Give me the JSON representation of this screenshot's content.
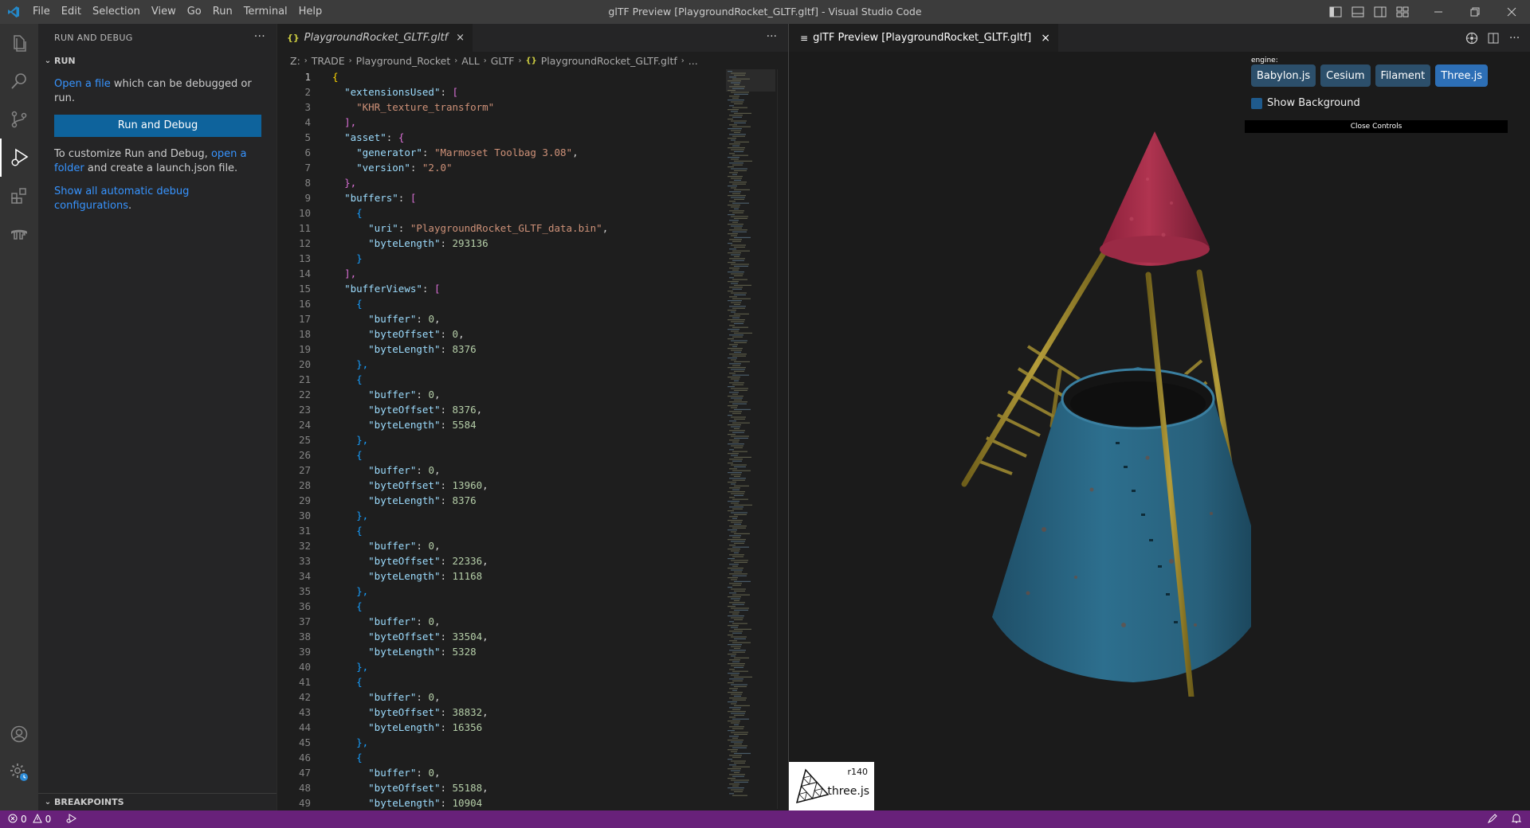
{
  "titlebar": {
    "menu": [
      "File",
      "Edit",
      "Selection",
      "View",
      "Go",
      "Run",
      "Terminal",
      "Help"
    ],
    "title": "glTF Preview [PlaygroundRocket_GLTF.gltf] - Visual Studio Code"
  },
  "sidebar": {
    "header": "RUN AND DEBUG",
    "more": "···",
    "section": "RUN",
    "open_file_link": "Open a file",
    "open_file_rest": " which can be debugged or run.",
    "run_button": "Run and Debug",
    "customize_pre": "To customize Run and Debug, ",
    "open_folder_link": "open a folder",
    "customize_post": " and create a launch.json file.",
    "show_all_link": "Show all automatic debug configurations",
    "show_all_period": ".",
    "breakpoints": "BREAKPOINTS"
  },
  "editor": {
    "tab_icon": "{}",
    "tab_label": "PlaygroundRocket_GLTF.gltf",
    "tab_close": "×",
    "more": "···",
    "breadcrumb": [
      "Z:",
      "TRADE",
      "Playground_Rocket",
      "ALL",
      "GLTF",
      "PlaygroundRocket_GLTF.gltf",
      "..."
    ],
    "breadcrumb_icon": "{}",
    "lines": [
      {
        "n": "1",
        "t": [
          [
            "{",
            "b1"
          ]
        ]
      },
      {
        "n": "2",
        "t": [
          [
            "  ",
            ""
          ],
          [
            "\"extensionsUsed\"",
            "k"
          ],
          [
            ": ",
            ""
          ],
          [
            "[",
            "b2"
          ]
        ]
      },
      {
        "n": "3",
        "t": [
          [
            "    ",
            ""
          ],
          [
            "\"KHR_texture_transform\"",
            "s"
          ]
        ]
      },
      {
        "n": "4",
        "t": [
          [
            "  ",
            ""
          ],
          [
            "],",
            "b2"
          ]
        ]
      },
      {
        "n": "5",
        "t": [
          [
            "  ",
            ""
          ],
          [
            "\"asset\"",
            "k"
          ],
          [
            ": ",
            ""
          ],
          [
            "{",
            "b2"
          ]
        ]
      },
      {
        "n": "6",
        "t": [
          [
            "    ",
            ""
          ],
          [
            "\"generator\"",
            "k"
          ],
          [
            ": ",
            ""
          ],
          [
            "\"Marmoset Toolbag 3.08\"",
            "s"
          ],
          [
            ",",
            ""
          ]
        ]
      },
      {
        "n": "7",
        "t": [
          [
            "    ",
            ""
          ],
          [
            "\"version\"",
            "k"
          ],
          [
            ": ",
            ""
          ],
          [
            "\"2.0\"",
            "s"
          ]
        ]
      },
      {
        "n": "8",
        "t": [
          [
            "  ",
            ""
          ],
          [
            "},",
            "b2"
          ]
        ]
      },
      {
        "n": "9",
        "t": [
          [
            "  ",
            ""
          ],
          [
            "\"buffers\"",
            "k"
          ],
          [
            ": ",
            ""
          ],
          [
            "[",
            "b2"
          ]
        ]
      },
      {
        "n": "10",
        "t": [
          [
            "    ",
            ""
          ],
          [
            "{",
            "b3"
          ]
        ]
      },
      {
        "n": "11",
        "t": [
          [
            "      ",
            ""
          ],
          [
            "\"uri\"",
            "k"
          ],
          [
            ": ",
            ""
          ],
          [
            "\"PlaygroundRocket_GLTF_data.bin\"",
            "s"
          ],
          [
            ",",
            ""
          ]
        ]
      },
      {
        "n": "12",
        "t": [
          [
            "      ",
            ""
          ],
          [
            "\"byteLength\"",
            "k"
          ],
          [
            ": ",
            ""
          ],
          [
            "293136",
            "n"
          ]
        ]
      },
      {
        "n": "13",
        "t": [
          [
            "    ",
            ""
          ],
          [
            "}",
            "b3"
          ]
        ]
      },
      {
        "n": "14",
        "t": [
          [
            "  ",
            ""
          ],
          [
            "],",
            "b2"
          ]
        ]
      },
      {
        "n": "15",
        "t": [
          [
            "  ",
            ""
          ],
          [
            "\"bufferViews\"",
            "k"
          ],
          [
            ": ",
            ""
          ],
          [
            "[",
            "b2"
          ]
        ]
      },
      {
        "n": "16",
        "t": [
          [
            "    ",
            ""
          ],
          [
            "{",
            "b3"
          ]
        ]
      },
      {
        "n": "17",
        "t": [
          [
            "      ",
            ""
          ],
          [
            "\"buffer\"",
            "k"
          ],
          [
            ": ",
            ""
          ],
          [
            "0",
            "n"
          ],
          [
            ",",
            ""
          ]
        ]
      },
      {
        "n": "18",
        "t": [
          [
            "      ",
            ""
          ],
          [
            "\"byteOffset\"",
            "k"
          ],
          [
            ": ",
            ""
          ],
          [
            "0",
            "n"
          ],
          [
            ",",
            ""
          ]
        ]
      },
      {
        "n": "19",
        "t": [
          [
            "      ",
            ""
          ],
          [
            "\"byteLength\"",
            "k"
          ],
          [
            ": ",
            ""
          ],
          [
            "8376",
            "n"
          ]
        ]
      },
      {
        "n": "20",
        "t": [
          [
            "    ",
            ""
          ],
          [
            "},",
            "b3"
          ]
        ]
      },
      {
        "n": "21",
        "t": [
          [
            "    ",
            ""
          ],
          [
            "{",
            "b3"
          ]
        ]
      },
      {
        "n": "22",
        "t": [
          [
            "      ",
            ""
          ],
          [
            "\"buffer\"",
            "k"
          ],
          [
            ": ",
            ""
          ],
          [
            "0",
            "n"
          ],
          [
            ",",
            ""
          ]
        ]
      },
      {
        "n": "23",
        "t": [
          [
            "      ",
            ""
          ],
          [
            "\"byteOffset\"",
            "k"
          ],
          [
            ": ",
            ""
          ],
          [
            "8376",
            "n"
          ],
          [
            ",",
            ""
          ]
        ]
      },
      {
        "n": "24",
        "t": [
          [
            "      ",
            ""
          ],
          [
            "\"byteLength\"",
            "k"
          ],
          [
            ": ",
            ""
          ],
          [
            "5584",
            "n"
          ]
        ]
      },
      {
        "n": "25",
        "t": [
          [
            "    ",
            ""
          ],
          [
            "},",
            "b3"
          ]
        ]
      },
      {
        "n": "26",
        "t": [
          [
            "    ",
            ""
          ],
          [
            "{",
            "b3"
          ]
        ]
      },
      {
        "n": "27",
        "t": [
          [
            "      ",
            ""
          ],
          [
            "\"buffer\"",
            "k"
          ],
          [
            ": ",
            ""
          ],
          [
            "0",
            "n"
          ],
          [
            ",",
            ""
          ]
        ]
      },
      {
        "n": "28",
        "t": [
          [
            "      ",
            ""
          ],
          [
            "\"byteOffset\"",
            "k"
          ],
          [
            ": ",
            ""
          ],
          [
            "13960",
            "n"
          ],
          [
            ",",
            ""
          ]
        ]
      },
      {
        "n": "29",
        "t": [
          [
            "      ",
            ""
          ],
          [
            "\"byteLength\"",
            "k"
          ],
          [
            ": ",
            ""
          ],
          [
            "8376",
            "n"
          ]
        ]
      },
      {
        "n": "30",
        "t": [
          [
            "    ",
            ""
          ],
          [
            "},",
            "b3"
          ]
        ]
      },
      {
        "n": "31",
        "t": [
          [
            "    ",
            ""
          ],
          [
            "{",
            "b3"
          ]
        ]
      },
      {
        "n": "32",
        "t": [
          [
            "      ",
            ""
          ],
          [
            "\"buffer\"",
            "k"
          ],
          [
            ": ",
            ""
          ],
          [
            "0",
            "n"
          ],
          [
            ",",
            ""
          ]
        ]
      },
      {
        "n": "33",
        "t": [
          [
            "      ",
            ""
          ],
          [
            "\"byteOffset\"",
            "k"
          ],
          [
            ": ",
            ""
          ],
          [
            "22336",
            "n"
          ],
          [
            ",",
            ""
          ]
        ]
      },
      {
        "n": "34",
        "t": [
          [
            "      ",
            ""
          ],
          [
            "\"byteLength\"",
            "k"
          ],
          [
            ": ",
            ""
          ],
          [
            "11168",
            "n"
          ]
        ]
      },
      {
        "n": "35",
        "t": [
          [
            "    ",
            ""
          ],
          [
            "},",
            "b3"
          ]
        ]
      },
      {
        "n": "36",
        "t": [
          [
            "    ",
            ""
          ],
          [
            "{",
            "b3"
          ]
        ]
      },
      {
        "n": "37",
        "t": [
          [
            "      ",
            ""
          ],
          [
            "\"buffer\"",
            "k"
          ],
          [
            ": ",
            ""
          ],
          [
            "0",
            "n"
          ],
          [
            ",",
            ""
          ]
        ]
      },
      {
        "n": "38",
        "t": [
          [
            "      ",
            ""
          ],
          [
            "\"byteOffset\"",
            "k"
          ],
          [
            ": ",
            ""
          ],
          [
            "33504",
            "n"
          ],
          [
            ",",
            ""
          ]
        ]
      },
      {
        "n": "39",
        "t": [
          [
            "      ",
            ""
          ],
          [
            "\"byteLength\"",
            "k"
          ],
          [
            ": ",
            ""
          ],
          [
            "5328",
            "n"
          ]
        ]
      },
      {
        "n": "40",
        "t": [
          [
            "    ",
            ""
          ],
          [
            "},",
            "b3"
          ]
        ]
      },
      {
        "n": "41",
        "t": [
          [
            "    ",
            ""
          ],
          [
            "{",
            "b3"
          ]
        ]
      },
      {
        "n": "42",
        "t": [
          [
            "      ",
            ""
          ],
          [
            "\"buffer\"",
            "k"
          ],
          [
            ": ",
            ""
          ],
          [
            "0",
            "n"
          ],
          [
            ",",
            ""
          ]
        ]
      },
      {
        "n": "43",
        "t": [
          [
            "      ",
            ""
          ],
          [
            "\"byteOffset\"",
            "k"
          ],
          [
            ": ",
            ""
          ],
          [
            "38832",
            "n"
          ],
          [
            ",",
            ""
          ]
        ]
      },
      {
        "n": "44",
        "t": [
          [
            "      ",
            ""
          ],
          [
            "\"byteLength\"",
            "k"
          ],
          [
            ": ",
            ""
          ],
          [
            "16356",
            "n"
          ]
        ]
      },
      {
        "n": "45",
        "t": [
          [
            "    ",
            ""
          ],
          [
            "},",
            "b3"
          ]
        ]
      },
      {
        "n": "46",
        "t": [
          [
            "    ",
            ""
          ],
          [
            "{",
            "b3"
          ]
        ]
      },
      {
        "n": "47",
        "t": [
          [
            "      ",
            ""
          ],
          [
            "\"buffer\"",
            "k"
          ],
          [
            ": ",
            ""
          ],
          [
            "0",
            "n"
          ],
          [
            ",",
            ""
          ]
        ]
      },
      {
        "n": "48",
        "t": [
          [
            "      ",
            ""
          ],
          [
            "\"byteOffset\"",
            "k"
          ],
          [
            ": ",
            ""
          ],
          [
            "55188",
            "n"
          ],
          [
            ",",
            ""
          ]
        ]
      },
      {
        "n": "49",
        "t": [
          [
            "      ",
            ""
          ],
          [
            "\"byteLength\"",
            "k"
          ],
          [
            ": ",
            ""
          ],
          [
            "10904",
            "n"
          ]
        ]
      }
    ]
  },
  "preview": {
    "tab_icon": "≡",
    "tab_label": "glTF Preview [PlaygroundRocket_GLTF.gltf]",
    "tab_close": "×",
    "more": "···",
    "engine_label": "engine:",
    "engines": [
      "Babylon.js",
      "Cesium",
      "Filament",
      "Three.js"
    ],
    "selected_engine": "Three.js",
    "show_background": "Show Background",
    "close_controls": "Close Controls",
    "badge_revision": "r140",
    "badge_name": "three.js"
  },
  "statusbar": {
    "errors": "0",
    "warnings": "0"
  },
  "colors": {
    "accent": "#0e639c",
    "statusbar": "#68217a",
    "cone_top": "#b03450",
    "cone_base": "#2d6f8e",
    "poles": "#a08a2a"
  }
}
